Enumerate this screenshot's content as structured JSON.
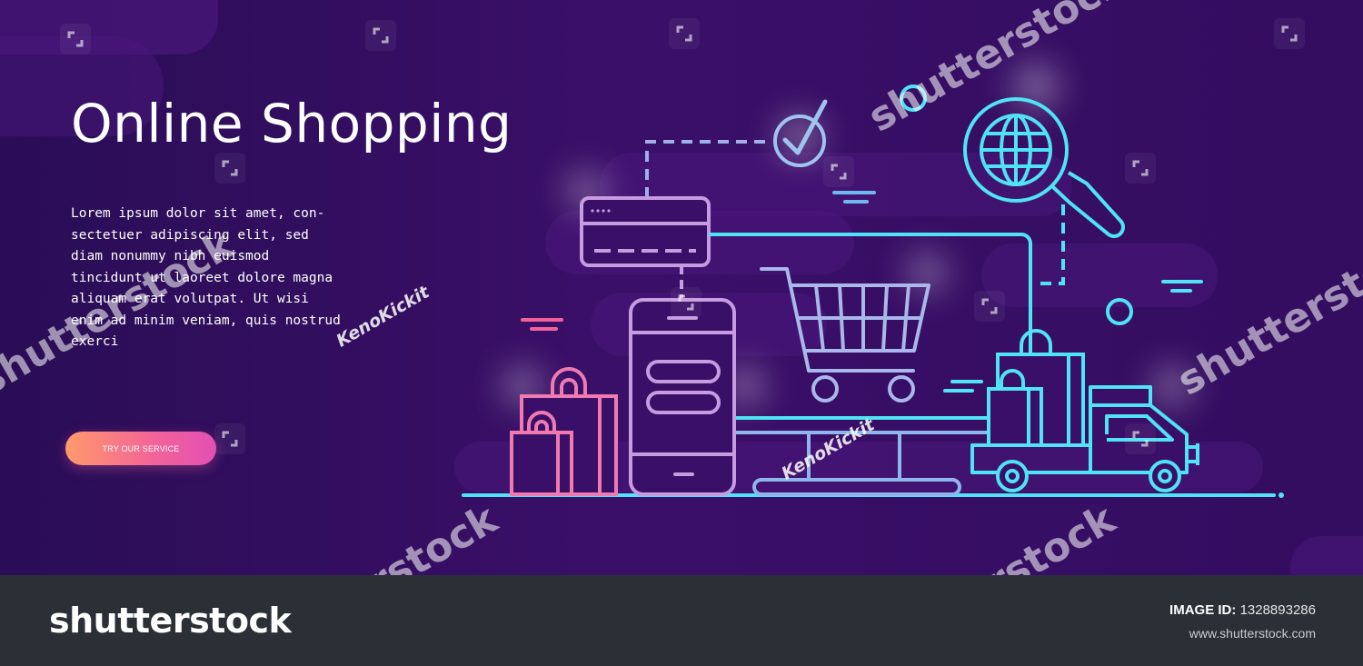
{
  "hero": {
    "title": "Online Shopping",
    "description": "Lorem ipsum dolor sit amet, con-sectetuer adipiscing elit, sed diam nonummy nibh euismod tincidunt ut laoreet dolore magna aliquam erat volutpat. Ut wisi enim ad minim veniam, quis nostrud exerci",
    "cta_label": "TRY OUR SERVICE"
  },
  "watermark": {
    "brand_text": "shutterstock",
    "author_text": "KenoKickit"
  },
  "footer": {
    "logo_text": "shutterstock",
    "image_id_label": "IMAGE ID:",
    "image_id_value": "1328893286",
    "website": "www.shutterstock.com"
  },
  "colors": {
    "background": "#3a0f68",
    "accent_pink": "#f2629a",
    "accent_cyan": "#4fe3f5",
    "footer": "#2b2f36"
  },
  "icons": [
    "shopping-bag-icon",
    "smartphone-icon",
    "shopping-cart-icon",
    "credit-card-icon",
    "checkmark-icon",
    "globe-search-icon",
    "delivery-truck-icon",
    "monitor-icon"
  ]
}
